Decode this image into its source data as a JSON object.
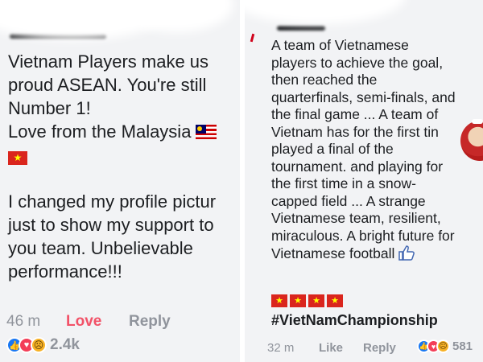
{
  "left_comment": {
    "lines": [
      "Vietnam Players make us",
      "proud ASEAN. You're still",
      "Number 1!",
      "Love from the Malaysia",
      "I changed my profile pictur",
      "just to show my support to",
      "you team. Unbelievable",
      "performance!!!"
    ],
    "time": "46 m",
    "reaction_label": "Love",
    "reply_label": "Reply",
    "reaction_count": "2.4k"
  },
  "right_comment": {
    "lines": [
      "A team of Vietnamese",
      "players to achieve the goal,",
      "then reached the",
      "quarterfinals, semi-finals, and",
      "the final game ... A team of",
      "Vietnam has for the first tin",
      "played a final of the",
      "tournament. and playing for",
      "the first time in a snow-",
      "capped field ... A strange",
      "Vietnamese team, resilient,",
      "miraculous. A bright future for",
      "Vietnamese football"
    ],
    "hashtag": "#VietNamChampionship",
    "time": "32 m",
    "like_label": "Like",
    "reply_label": "Reply",
    "reaction_count": "581"
  },
  "icons": {
    "malaysia_flag": "flag-malaysia-icon",
    "vietnam_flag": "flag-vietnam-icon",
    "thumbs_up": "thumbs-up-icon",
    "like_reaction": "like-reaction-icon",
    "love_reaction": "love-reaction-icon",
    "sad_reaction": "sad-reaction-icon"
  },
  "colors": {
    "love": "#f25268",
    "meta": "#90949c",
    "like_blue": "#1877f2",
    "vietnam_red": "#da251d"
  }
}
